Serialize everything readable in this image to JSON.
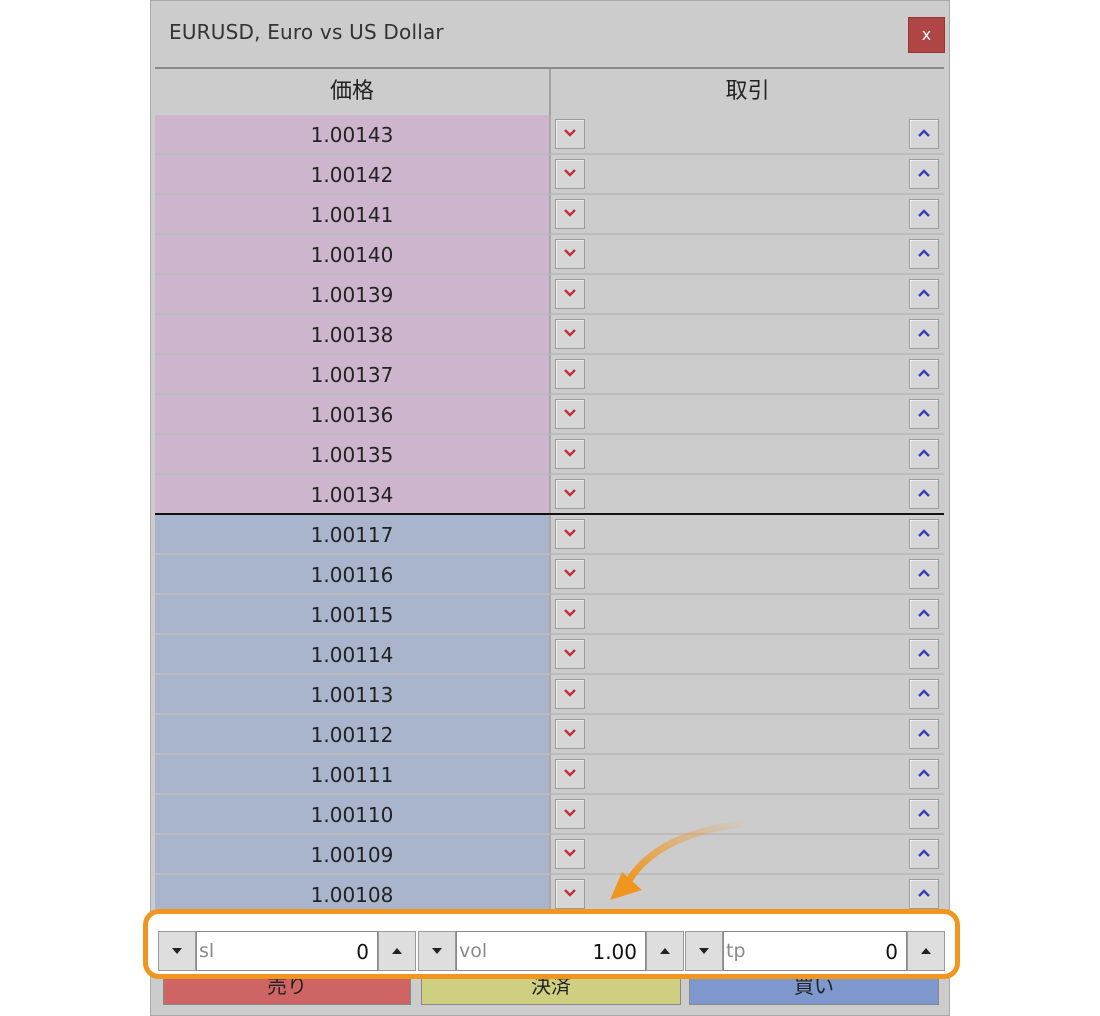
{
  "window": {
    "title": "EURUSD, Euro vs US Dollar",
    "close_label": "x"
  },
  "columns": {
    "price": "価格",
    "trade": "取引"
  },
  "ask_prices": [
    "1.00143",
    "1.00142",
    "1.00141",
    "1.00140",
    "1.00139",
    "1.00138",
    "1.00137",
    "1.00136",
    "1.00135",
    "1.00134"
  ],
  "bid_prices": [
    "1.00117",
    "1.00116",
    "1.00115",
    "1.00114",
    "1.00113",
    "1.00112",
    "1.00111",
    "1.00110",
    "1.00109",
    "1.00108"
  ],
  "controls": {
    "sl": {
      "placeholder": "sl",
      "value": "0"
    },
    "vol": {
      "placeholder": "vol",
      "value": "1.00"
    },
    "tp": {
      "placeholder": "tp",
      "value": "0"
    }
  },
  "buttons": {
    "sell": "売り",
    "close": "決済",
    "buy": "買い"
  },
  "colors": {
    "ask_row": "#cdb6cd",
    "bid_row": "#a9b5cd",
    "sell": "#cf6464",
    "close": "#cfcf82",
    "buy": "#7e97cd",
    "highlight": "#f0961e",
    "down_arrow": "#c0303a",
    "up_arrow": "#3540b8"
  },
  "icons": {
    "down": "chevron-down-icon",
    "up": "chevron-up-icon",
    "spin_down": "triangle-down-icon",
    "spin_up": "triangle-up-icon",
    "callout": "curved-arrow-icon"
  }
}
